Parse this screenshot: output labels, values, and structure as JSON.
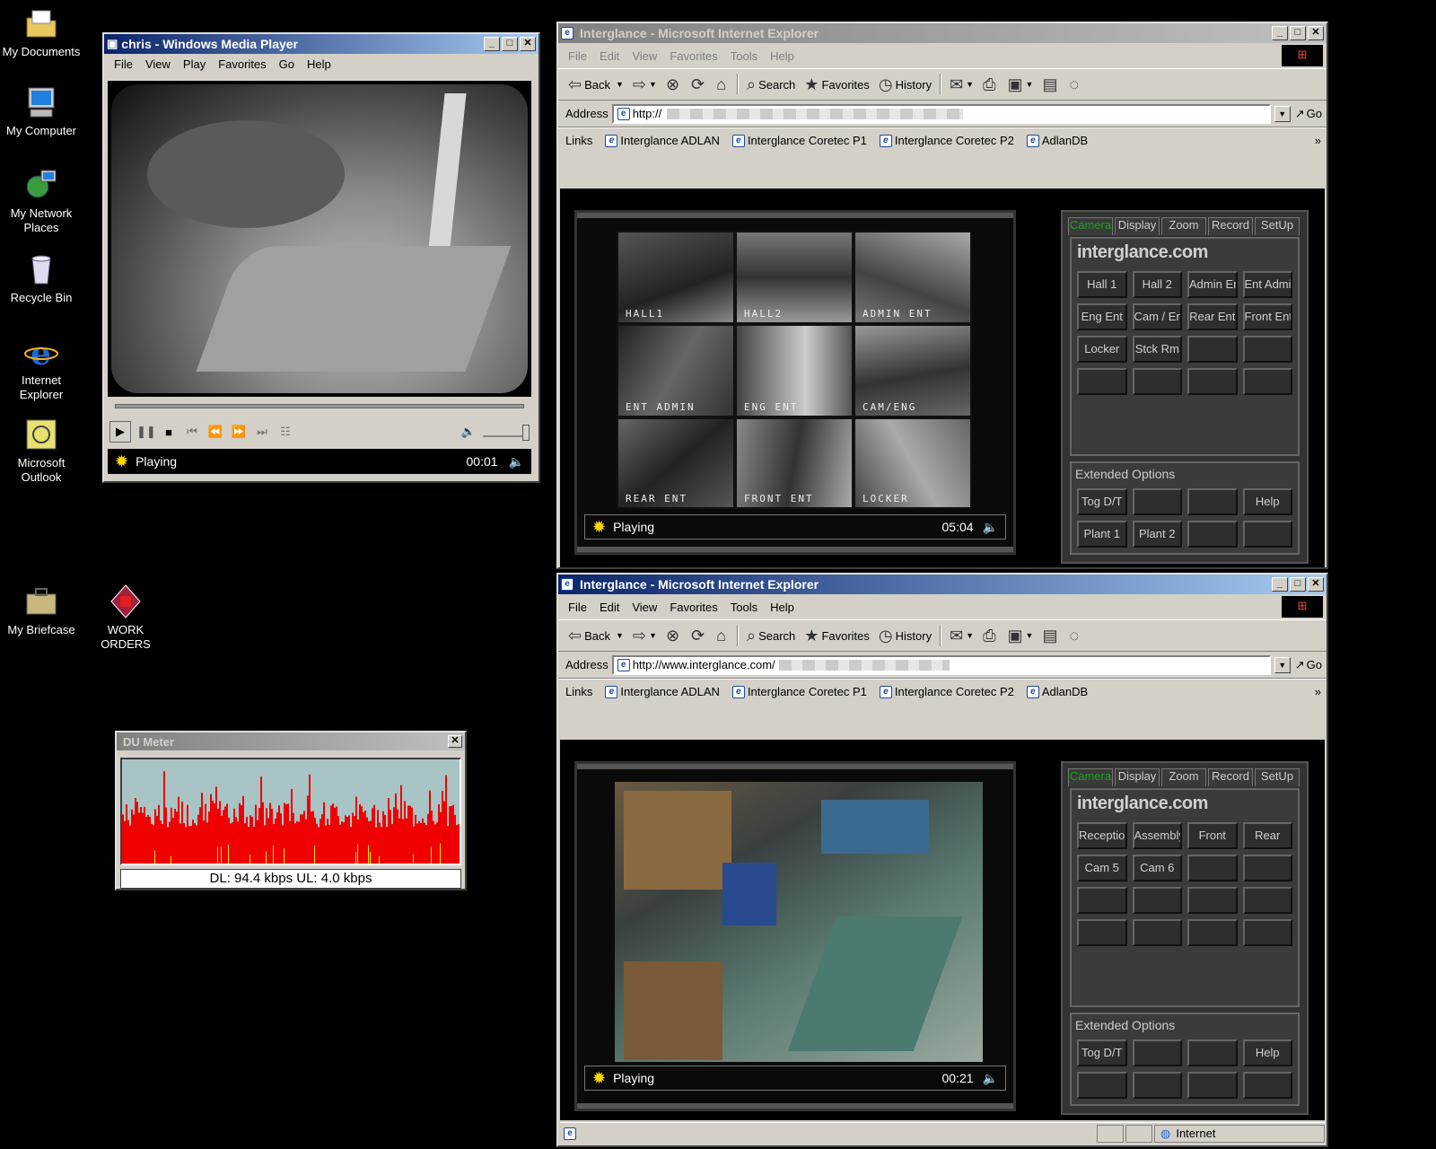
{
  "desktop": {
    "icons": [
      {
        "label": "My Documents"
      },
      {
        "label": "My Computer"
      },
      {
        "label": "My Network Places"
      },
      {
        "label": "Recycle Bin"
      },
      {
        "label": "Internet Explorer"
      },
      {
        "label": "Microsoft Outlook"
      },
      {
        "label": "My Briefcase"
      },
      {
        "label": "WORK ORDERS"
      }
    ]
  },
  "wmp": {
    "title": "chris - Windows Media Player",
    "menu": [
      "File",
      "View",
      "Play",
      "Favorites",
      "Go",
      "Help"
    ],
    "status": "Playing",
    "time": "00:01"
  },
  "dumeter": {
    "title": "DU Meter",
    "readout": "DL: 94.4 kbps  UL: 4.0 kbps"
  },
  "ie": {
    "title": "Interglance - Microsoft Internet Explorer",
    "menu": [
      "File",
      "Edit",
      "View",
      "Favorites",
      "Tools",
      "Help"
    ],
    "toolbar": {
      "back": "Back",
      "search": "Search",
      "favorites": "Favorites",
      "history": "History"
    },
    "address_label": "Address",
    "go": "Go",
    "links_label": "Links",
    "links": [
      "Interglance ADLAN",
      "Interglance Coretec P1",
      "Interglance Coretec P2",
      "AdlanDB"
    ]
  },
  "ie1": {
    "url": "http://",
    "player_status": "Playing",
    "player_time": "05:04",
    "cameras": [
      "HALL1",
      "HALL2",
      "ADMIN ENT",
      "ENT ADMIN",
      "ENG ENT",
      "CAM/ENG",
      "REAR ENT",
      "FRONT ENT",
      "LOCKER"
    ],
    "panel": {
      "tabs": [
        "Camera",
        "Display",
        "Zoom",
        "Record",
        "SetUp"
      ],
      "brand": "interglance.com",
      "buttons": [
        "Hall 1",
        "Hall 2",
        "Admin Ent",
        "Ent Admin",
        "Eng Ent",
        "Cam / Eng",
        "Rear Ent",
        "Front Ent",
        "Locker",
        "Stck Rm",
        "",
        "",
        "",
        "",
        "",
        ""
      ],
      "extended_label": "Extended Options",
      "ext_buttons": [
        "Tog D/T",
        "",
        "",
        "Help",
        "Plant 1",
        "Plant 2",
        "",
        ""
      ]
    }
  },
  "ie2": {
    "url": "http://www.interglance.com/",
    "player_status": "Playing",
    "player_time": "00:21",
    "panel": {
      "tabs": [
        "Camera",
        "Display",
        "Zoom",
        "Record",
        "SetUp"
      ],
      "brand": "interglance.com",
      "buttons": [
        "Reception",
        "Assembly",
        "Front",
        "Rear",
        "Cam 5",
        "Cam 6",
        "",
        "",
        "",
        "",
        "",
        "",
        "",
        "",
        "",
        ""
      ],
      "extended_label": "Extended Options",
      "ext_buttons": [
        "Tog D/T",
        "",
        "",
        "Help",
        "",
        "",
        "",
        ""
      ]
    },
    "statusbar_zone": "Internet"
  }
}
